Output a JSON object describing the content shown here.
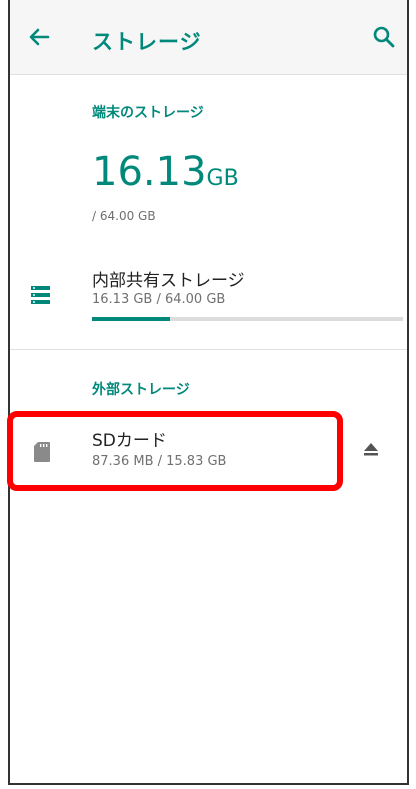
{
  "toolbar": {
    "title": "ストレージ",
    "back_icon": "arrow-back-icon",
    "search_icon": "search-icon"
  },
  "device_storage": {
    "section_label": "端末のストレージ",
    "used_value": "16.13",
    "used_unit": "GB",
    "total": "/ 64.00 GB"
  },
  "internal_shared": {
    "title": "内部共有ストレージ",
    "subtitle": "16.13 GB / 64.00 GB",
    "icon": "storage-list-icon",
    "usage_fraction": 0.252
  },
  "external_storage": {
    "section_label": "外部ストレージ",
    "sd_card": {
      "title": "SDカード",
      "subtitle": "87.36 MB / 15.83 GB",
      "icon": "sd-card-icon",
      "eject_icon": "eject-icon"
    }
  },
  "colors": {
    "accent": "#00897b",
    "highlight": "#ff0000",
    "toolbar_bg": "#f6f6f6"
  }
}
